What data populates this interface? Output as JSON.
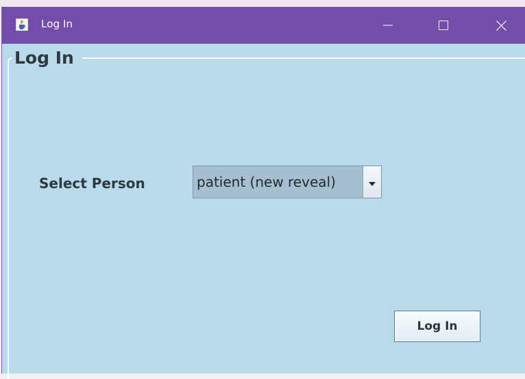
{
  "window": {
    "title": "Log In",
    "icon": "java-cup-icon",
    "controls": [
      "minimize-icon",
      "maximize-icon",
      "close-icon"
    ],
    "titlebar_color": "#744ca9"
  },
  "panel": {
    "group_title": "Log In",
    "background_color": "#b8daea"
  },
  "form": {
    "select_label": "Select Person",
    "selected_person": "patient (new reveal)",
    "dropdown_icon": "chevron-down-icon"
  },
  "actions": {
    "login_label": "Log In"
  }
}
